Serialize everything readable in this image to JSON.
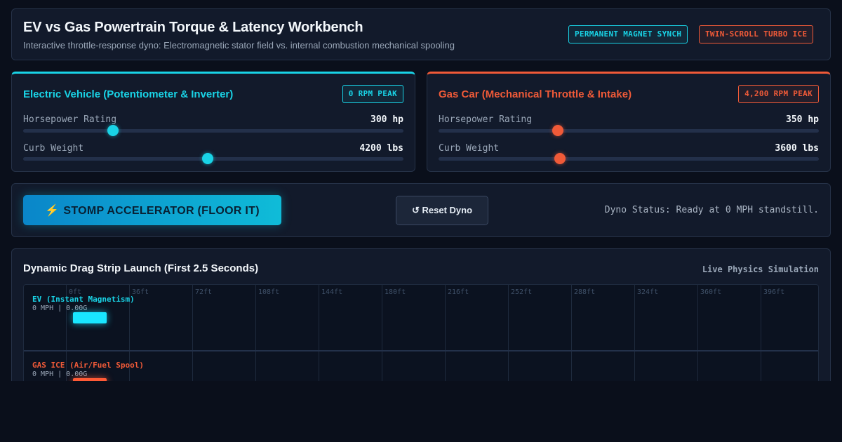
{
  "header": {
    "title": "EV vs Gas Powertrain Torque & Latency Workbench",
    "subtitle": "Interactive throttle-response dyno: Electromagnetic stator field vs. internal combustion mechanical spooling",
    "badges": [
      "PERMANENT MAGNET SYNCH",
      "TWIN-SCROLL TURBO ICE"
    ]
  },
  "ev": {
    "title": "Electric Vehicle (Potentiometer & Inverter)",
    "peak": "0 RPM PEAK",
    "hp_label": "Horsepower Rating",
    "hp_value": "300 hp",
    "hp_slider": 0.237,
    "weight_label": "Curb Weight",
    "weight_value": "4200 lbs",
    "weight_slider": 0.485
  },
  "gas": {
    "title": "Gas Car (Mechanical Throttle & Intake)",
    "peak": "4,200 RPM PEAK",
    "hp_label": "Horsepower Rating",
    "hp_value": "350 hp",
    "hp_slider": 0.314,
    "weight_label": "Curb Weight",
    "weight_value": "3600 lbs",
    "weight_slider": 0.319
  },
  "controls": {
    "stomp_label": "STOMP ACCELERATOR (FLOOR IT)",
    "stomp_icon": "lightning-bolt-icon",
    "reset_label": "↺ Reset Dyno",
    "status": "Dyno Status: Ready at 0 MPH standstill."
  },
  "strip": {
    "title": "Dynamic Drag Strip Launch (First 2.5 Seconds)",
    "live": "Live Physics Simulation",
    "ticks": [
      "0ft",
      "36ft",
      "72ft",
      "108ft",
      "144ft",
      "180ft",
      "216ft",
      "252ft",
      "288ft",
      "324ft",
      "360ft",
      "396ft"
    ],
    "ev_lane": {
      "name": "EV (Instant Magnetism)",
      "readout": "0 MPH | 0.00G"
    },
    "gas_lane": {
      "name": "GAS ICE (Air/Fuel Spool)",
      "readout": "0 MPH | 0.00G"
    }
  },
  "colors": {
    "ev": "#19d3e6",
    "gas": "#f05a38",
    "bg": "#0a0f1b"
  }
}
